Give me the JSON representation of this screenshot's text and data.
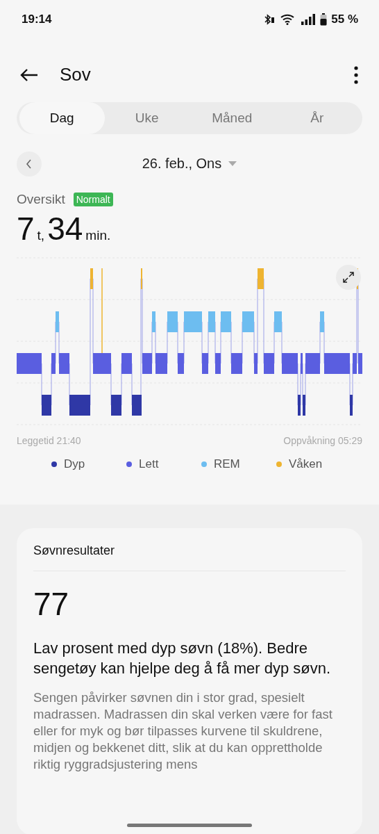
{
  "status_bar": {
    "time": "19:14",
    "battery": "55 %"
  },
  "header": {
    "title": "Sov"
  },
  "tabs": [
    {
      "label": "Dag",
      "selected": true
    },
    {
      "label": "Uke",
      "selected": false
    },
    {
      "label": "Måned",
      "selected": false
    },
    {
      "label": "År",
      "selected": false
    }
  ],
  "date": {
    "label": "26. feb., Ons"
  },
  "overview": {
    "label": "Oversikt",
    "badge": "Normalt",
    "hours": "7",
    "hours_unit": "t,",
    "minutes": "34",
    "minutes_unit": "min."
  },
  "sleep_chart": {
    "bedtime": "Leggetid 21:40",
    "wakeup": "Oppvåkning 05:29",
    "legend": [
      {
        "label": "Dyp",
        "color": "#2f38a6"
      },
      {
        "label": "Lett",
        "color": "#5a5ee0"
      },
      {
        "label": "REM",
        "color": "#6dbdf0"
      },
      {
        "label": "Våken",
        "color": "#eeb431"
      }
    ]
  },
  "results": {
    "title": "Søvnresultater",
    "score": "77",
    "headline": "Lav prosent med dyp søvn (18%). Bedre sengetøy kan hjelpe deg å få mer dyp søvn.",
    "body": "Sengen påvirker søvnen din i stor grad, spesielt madrassen. Madrassen din skal verken være for fast eller for myk og bør tilpasses kurvene til skuldrene, midjen og bekkenet ditt, slik at du kan opprettholde riktig ryggradsjustering mens"
  }
}
